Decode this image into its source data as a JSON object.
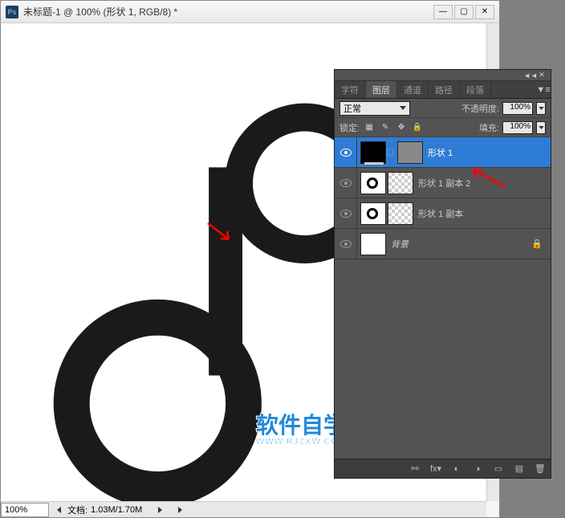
{
  "window": {
    "title": "未标题-1 @ 100% (形状 1, RGB/8) *",
    "ps": "Ps",
    "minimize": "—",
    "maximize": "▢",
    "close": "✕"
  },
  "statusbar": {
    "zoom": "100%",
    "doc_label": "文档:",
    "doc_value": "1.03M/1.70M"
  },
  "panel": {
    "collapse": "◄◄",
    "close": "✕",
    "tabs": {
      "char": "字符",
      "layers": "图层",
      "channels": "通道",
      "paths": "路径",
      "paragraphs": "段落"
    },
    "menu": "▼≡",
    "blend_mode": "正常",
    "opacity_label": "不透明度:",
    "opacity_value": "100%",
    "lock_label": "锁定:",
    "fill_label": "填充:",
    "fill_value": "100%",
    "lock_icons": {
      "transparent": "▦",
      "pixels": "✎",
      "position": "✥",
      "all": "🔒"
    },
    "layers": [
      {
        "name": "形状 1",
        "selected": true,
        "thumb": "shape-black",
        "mask": true
      },
      {
        "name": "形状 1 副本 2",
        "selected": false,
        "thumb": "ring",
        "checker": true
      },
      {
        "name": "形状 1 副本",
        "selected": false,
        "thumb": "ring",
        "checker": true
      },
      {
        "name": "背景",
        "selected": false,
        "thumb": "white",
        "locked": true,
        "italic": true
      }
    ],
    "footer": {
      "link": "⚯",
      "fx": "fx▾",
      "mask": "◐",
      "adjust": "◑",
      "group": "▭",
      "new": "▤",
      "delete": "🗑"
    }
  },
  "watermark": {
    "main": "软件自学网",
    "sub": "WWW.RJZXW.COM"
  }
}
